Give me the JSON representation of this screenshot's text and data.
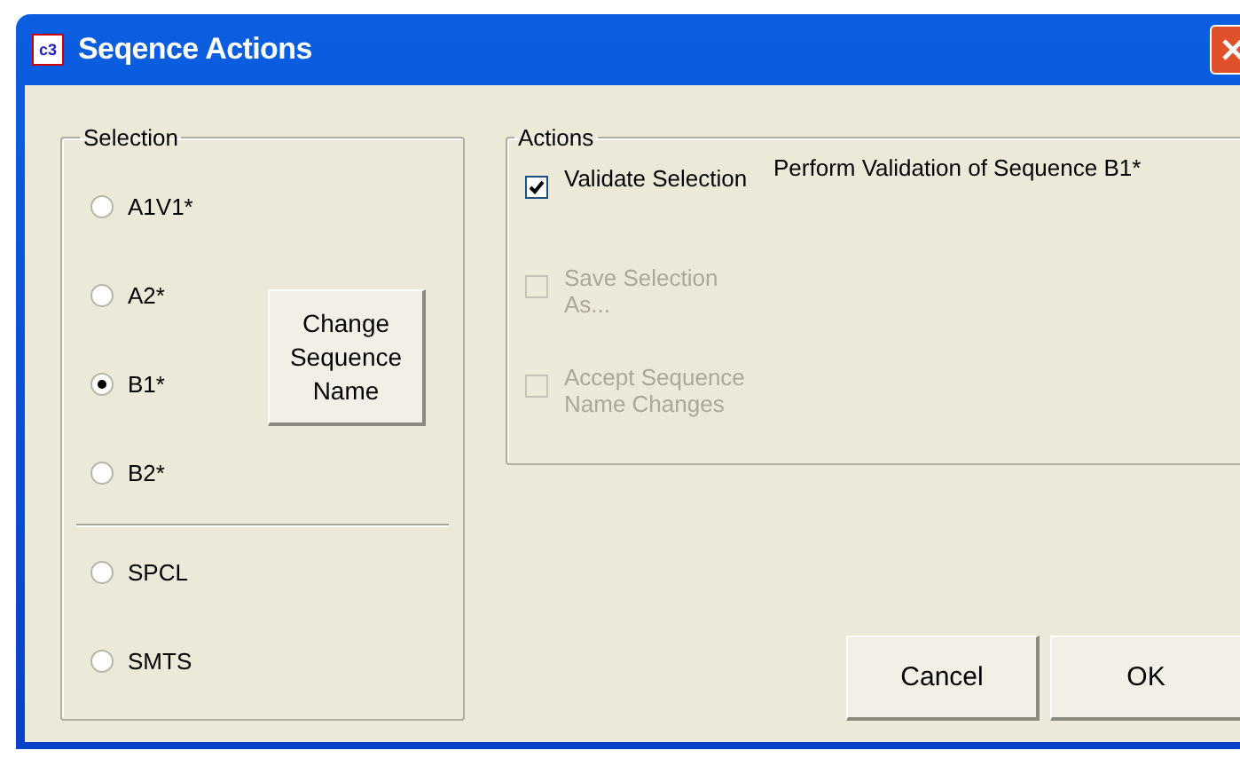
{
  "window": {
    "title": "Seqence Actions",
    "icon_text": "c3"
  },
  "selection": {
    "label": "Selection",
    "options": [
      {
        "label": "A1V1*",
        "selected": false
      },
      {
        "label": "A2*",
        "selected": false
      },
      {
        "label": "B1*",
        "selected": true
      },
      {
        "label": "B2*",
        "selected": false
      }
    ],
    "extra_options": [
      {
        "label": "SPCL",
        "selected": false
      },
      {
        "label": "SMTS",
        "selected": false
      }
    ],
    "change_button": "Change Sequence Name"
  },
  "actions": {
    "label": "Actions",
    "items": [
      {
        "label": "Validate Selection",
        "checked": true,
        "disabled": false
      },
      {
        "label": "Save Selection As...",
        "checked": false,
        "disabled": true
      },
      {
        "label": "Accept Sequence Name Changes",
        "checked": false,
        "disabled": true
      }
    ],
    "description": "Perform Validation of Sequence B1*"
  },
  "buttons": [
    "Cancel",
    "OK"
  ]
}
